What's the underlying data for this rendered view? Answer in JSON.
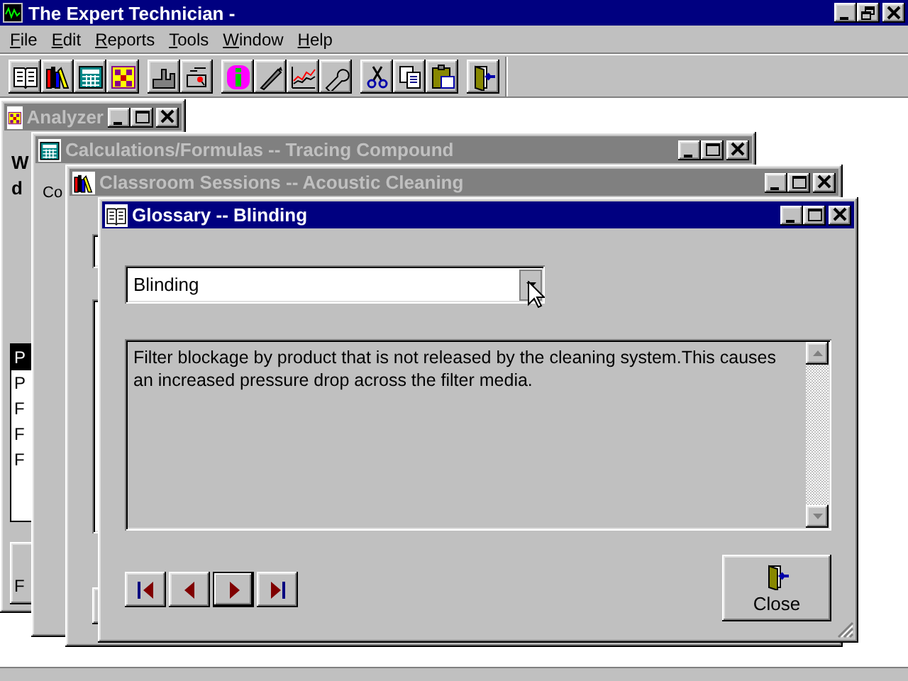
{
  "app": {
    "title": "The Expert Technician -",
    "menu": [
      {
        "label": "File"
      },
      {
        "label": "Edit"
      },
      {
        "label": "Reports"
      },
      {
        "label": "Tools"
      },
      {
        "label": "Window"
      },
      {
        "label": "Help"
      }
    ]
  },
  "windows": [
    {
      "kind": "analyzer",
      "title": "Analyzer",
      "active": false,
      "texts": [
        "W",
        "d"
      ],
      "list": [
        {
          "label": "P",
          "selected": true
        },
        {
          "label": "P",
          "selected": false
        },
        {
          "label": "F",
          "selected": false
        },
        {
          "label": "F",
          "selected": false
        },
        {
          "label": "F",
          "selected": false
        }
      ],
      "button": "F"
    },
    {
      "kind": "calculations",
      "title": "Calculations/Formulas -- Tracing Compound",
      "active": false,
      "label": "Co"
    },
    {
      "kind": "classroom",
      "title": "Classroom Sessions -- Acoustic Cleaning",
      "active": false
    },
    {
      "kind": "glossary",
      "title": "Glossary -- Blinding",
      "active": true,
      "term": "Blinding",
      "definition": "Filter blockage by product that is not released by the cleaning system.This causes an increased pressure drop across the filter media.",
      "nav_buttons": [
        {
          "kind": "first",
          "default": false
        },
        {
          "kind": "previous",
          "default": false
        },
        {
          "kind": "next",
          "default": true
        },
        {
          "kind": "last",
          "default": false
        }
      ],
      "close_button": "Close"
    }
  ]
}
